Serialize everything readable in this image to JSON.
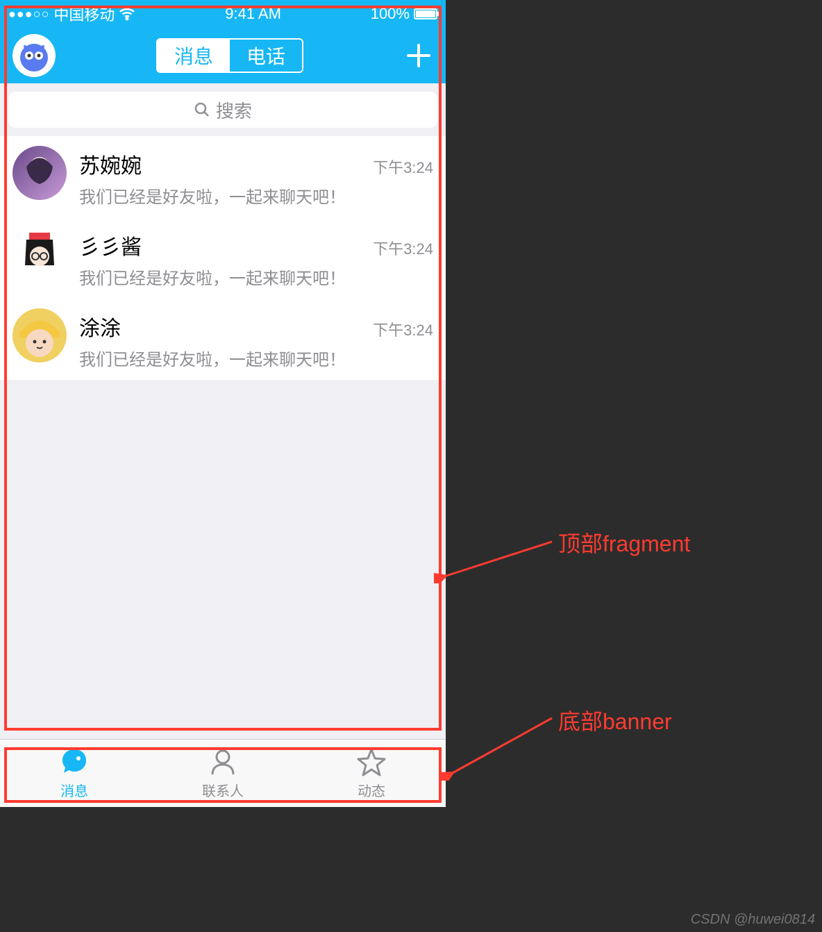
{
  "status_bar": {
    "carrier": "中国移动",
    "time": "9:41 AM",
    "battery_pct": "100%"
  },
  "header": {
    "seg_message": "消息",
    "seg_phone": "电话"
  },
  "search": {
    "placeholder": "搜索"
  },
  "chats": [
    {
      "name": "苏婉婉",
      "message": "我们已经是好友啦，一起来聊天吧！",
      "time": "下午3:24"
    },
    {
      "name": "彡彡酱",
      "message": "我们已经是好友啦，一起来聊天吧！",
      "time": "下午3:24"
    },
    {
      "name": "涂涂",
      "message": "我们已经是好友啦，一起来聊天吧！",
      "time": "下午3:24"
    }
  ],
  "tabs": {
    "messages": "消息",
    "contacts": "联系人",
    "moments": "动态"
  },
  "annotations": {
    "top_fragment": "顶部fragment",
    "bottom_banner": "底部banner"
  },
  "watermark": "CSDN @huwei0814",
  "colors": {
    "primary": "#16b7f4",
    "danger": "#ff3b30",
    "muted": "#8e8e93"
  }
}
